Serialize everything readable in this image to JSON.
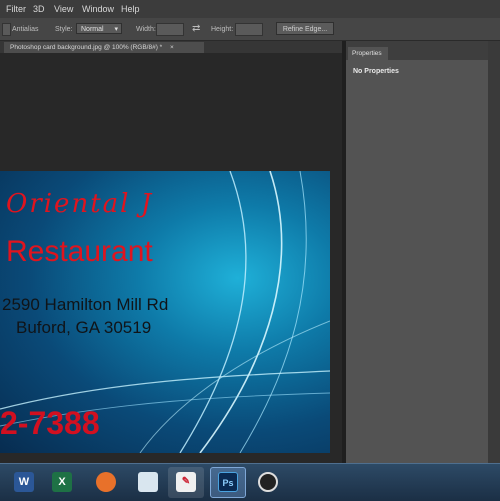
{
  "menu": {
    "items": [
      "Filter",
      "3D",
      "View",
      "Window",
      "Help"
    ]
  },
  "options": {
    "antialias_label": "Antialias",
    "style_label": "Style:",
    "style_value": "Normal",
    "width_label": "Width:",
    "height_label": "Height:",
    "refine_edge_label": "Refine Edge..."
  },
  "document": {
    "tab_title": "Photoshop card background.jpg @ 100% (RGB/8#) *",
    "card": {
      "name_line1": "Oriental J",
      "name_line2": "Restaurant",
      "address_line1": "2590 Hamilton Mill Rd",
      "address_line2": "Buford, GA 30519",
      "phone_partial": "2-7388"
    }
  },
  "properties_panel": {
    "tab_label": "Properties",
    "message": "No Properties"
  },
  "taskbar": {
    "icons": [
      "word-icon",
      "excel-icon",
      "firefox-icon",
      "notepad-icon",
      "paint-icon",
      "photoshop-icon",
      "obs-icon"
    ]
  }
}
